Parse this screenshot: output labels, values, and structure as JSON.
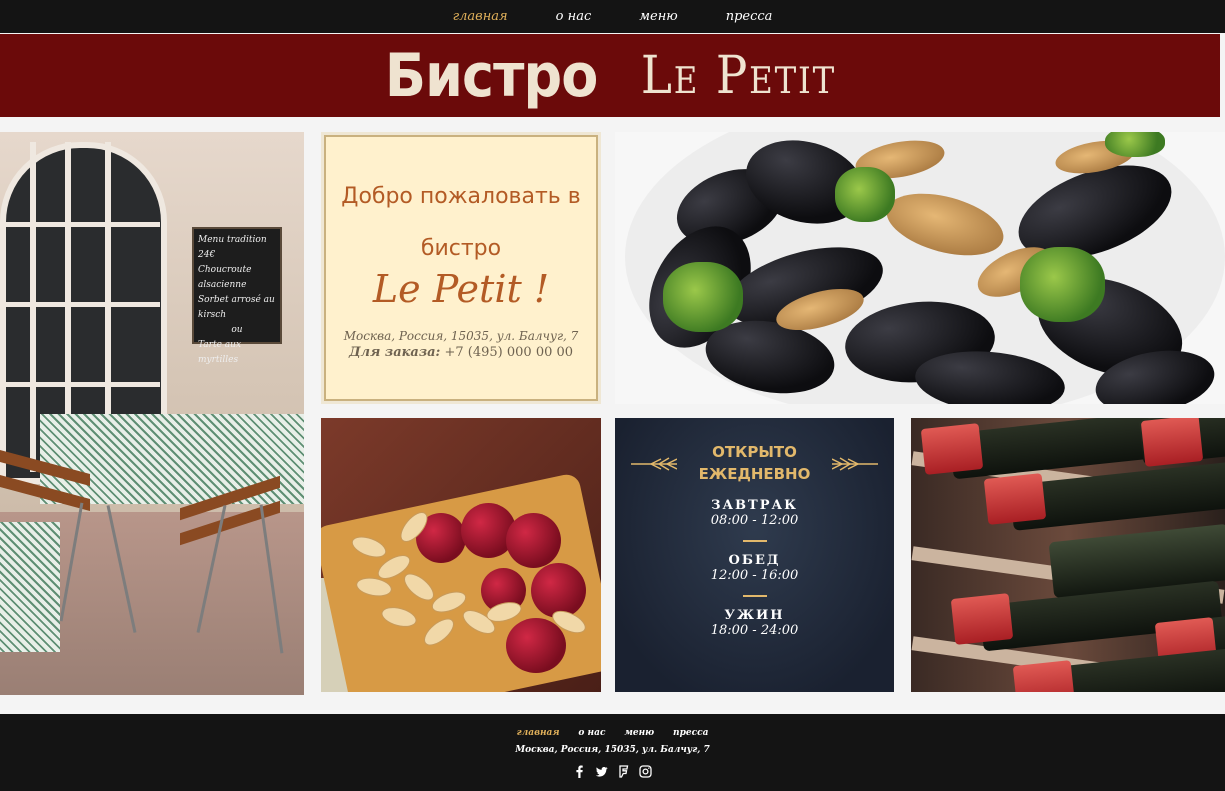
{
  "nav": {
    "items": [
      "главная",
      "о нас",
      "меню",
      "пресса"
    ],
    "active_index": 0
  },
  "brand": {
    "part1": "Бистро",
    "part2": "Le Petit"
  },
  "welcome": {
    "line1": "Добро пожаловать в",
    "line2": "бистро",
    "line3": "Le Petit !",
    "address": "Москва, Россия, 15035, ул. Балчуг, 7",
    "order_label": "Для заказа:",
    "order_phone": "+7 (495) 000 00 00"
  },
  "cafe_board": {
    "lines": [
      "Menu tradition 24€",
      "Choucroute alsacienne",
      "Sorbet arrosé au kirsch",
      "ou",
      "Tarte aux myrtilles"
    ]
  },
  "hours": {
    "title_line1": "ОТКРЫТО",
    "title_line2": "ЕЖЕДНЕВНО",
    "meals": [
      {
        "name": "ЗАВТРАК",
        "time": "08:00 - 12:00"
      },
      {
        "name": "ОБЕД",
        "time": "12:00 - 16:00"
      },
      {
        "name": "УЖИН",
        "time": "18:00 - 24:00"
      }
    ]
  },
  "footer": {
    "nav": [
      "главная",
      "о нас",
      "меню",
      "пресса"
    ],
    "active_index": 0,
    "address": "Москва, Россия, 15035, ул. Балчуг, 7",
    "social_icons": [
      "facebook-icon",
      "twitter-icon",
      "foursquare-icon",
      "instagram-icon"
    ]
  },
  "colors": {
    "banner": "#6b0a0a",
    "accent": "#e0b05a",
    "nav_bg": "#141414",
    "welcome_text": "#b35b25"
  }
}
